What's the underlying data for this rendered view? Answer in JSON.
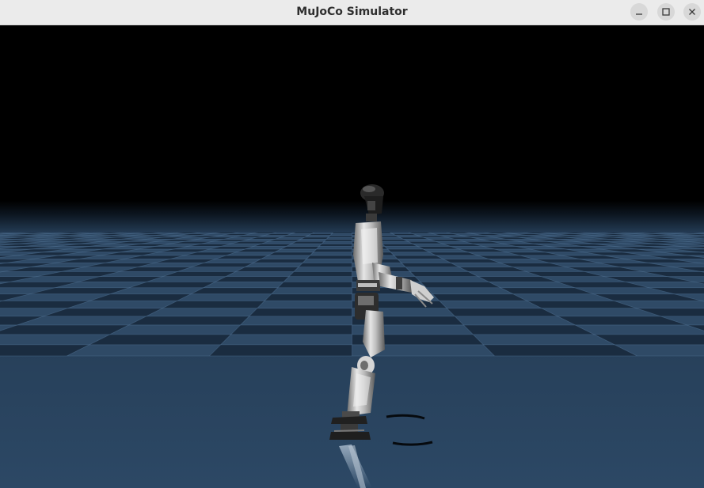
{
  "window": {
    "title": "MuJoCo Simulator",
    "controls": {
      "minimize": "minimize-icon",
      "maximize": "maximize-icon",
      "close": "close-icon"
    }
  },
  "scene": {
    "description_icon": "humanoid-robot",
    "floor_color": "#2f4a66",
    "floor_dark_color": "#1a2c40",
    "sky_color": "#000000"
  }
}
